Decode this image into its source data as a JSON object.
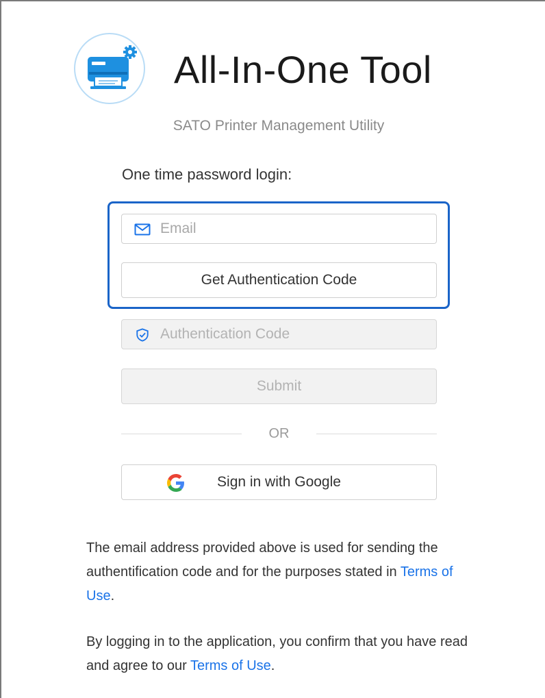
{
  "app": {
    "title": "All-In-One Tool",
    "subtitle": "SATO Printer Management Utility",
    "logo_icon": "printer-gear-icon"
  },
  "login": {
    "heading": "One time password login:",
    "email": {
      "placeholder": "Email",
      "value": "",
      "icon": "mail-icon"
    },
    "get_code_label": "Get Authentication Code",
    "auth_code": {
      "placeholder": "Authentication Code",
      "value": "",
      "icon": "shield-check-icon",
      "disabled": true
    },
    "submit_label": "Submit",
    "submit_disabled": true,
    "divider_label": "OR",
    "google_label": "Sign in with Google",
    "google_icon": "google-g-icon"
  },
  "notes": {
    "email_usage_prefix": "The email address provided above is used for sending the authentification code and for the purposes stated in ",
    "email_usage_link": "Terms of Use",
    "email_usage_suffix": ".",
    "consent_prefix": "By logging in to the application, you confirm that you have read and agree to our ",
    "consent_link": "Terms of Use",
    "consent_suffix": "."
  },
  "colors": {
    "focus_border": "#1a64c8",
    "link": "#1a73e8",
    "logo_blue": "#1e90e0",
    "disabled_bg": "#f2f2f2"
  }
}
